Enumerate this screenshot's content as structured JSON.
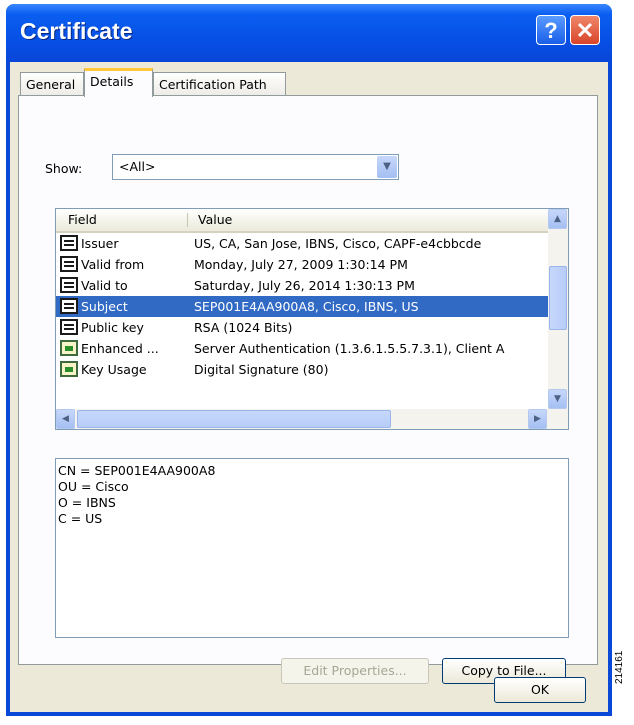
{
  "window": {
    "title": "Certificate",
    "help_label": "?",
    "close_label": "✕"
  },
  "tabs": [
    {
      "label": "General",
      "active": false
    },
    {
      "label": "Details",
      "active": true
    },
    {
      "label": "Certification Path",
      "active": false
    }
  ],
  "show": {
    "label": "Show:",
    "value": "<All>"
  },
  "fields_table": {
    "columns": [
      "Field",
      "Value"
    ],
    "rows": [
      {
        "icon": "certificate-field-icon",
        "field": "Issuer",
        "value": "US, CA, San Jose, IBNS, Cisco, CAPF-e4cbbcde"
      },
      {
        "icon": "certificate-field-icon",
        "field": "Valid from",
        "value": "Monday, July 27, 2009 1:30:14 PM"
      },
      {
        "icon": "certificate-field-icon",
        "field": "Valid to",
        "value": "Saturday, July 26, 2014 1:30:13 PM"
      },
      {
        "icon": "certificate-field-icon",
        "field": "Subject",
        "value": "SEP001E4AA900A8, Cisco, IBNS, US",
        "selected": true
      },
      {
        "icon": "certificate-field-icon",
        "field": "Public key",
        "value": "RSA (1024 Bits)"
      },
      {
        "icon": "extension-icon",
        "field": "Enhanced ...",
        "value": "Server Authentication (1.3.6.1.5.5.7.3.1), Client A"
      },
      {
        "icon": "critical-extension-icon",
        "field": "Key Usage",
        "value": "Digital Signature (80)"
      }
    ]
  },
  "detail_lines": [
    "CN = SEP001E4AA900A8",
    "OU = Cisco",
    "O = IBNS",
    "C = US"
  ],
  "buttons": {
    "edit": "Edit Properties...",
    "copy": "Copy to File...",
    "ok": "OK"
  },
  "figure_id": "214161"
}
